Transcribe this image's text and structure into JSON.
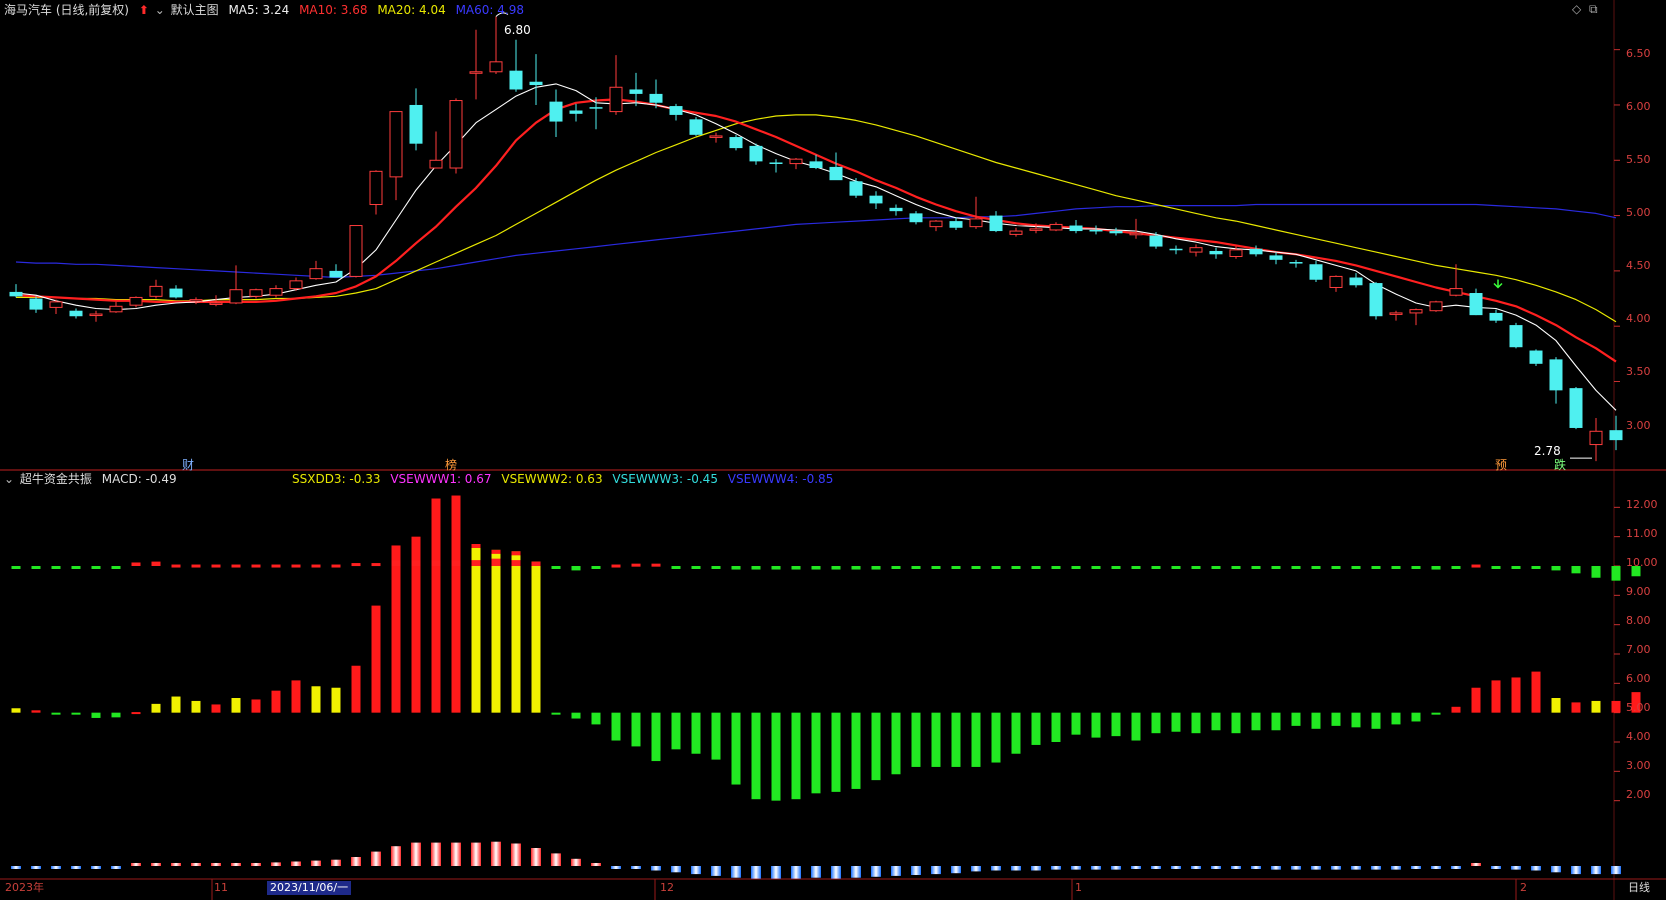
{
  "main_header": {
    "stock_title": "海马汽车 (日线,前复权)",
    "template": "默认主图",
    "ma5": "MA5: 3.24",
    "ma10": "MA10: 3.68",
    "ma20": "MA20: 4.04",
    "ma60": "MA60: 4.98"
  },
  "sub_header": {
    "indicator": "超牛资金共振",
    "macd": "MACD: -0.49",
    "ssxdd3": "SSXDD3: -0.33",
    "vw1": "VSEWWW1: 0.67",
    "vw2": "VSEWWW2: 0.63",
    "vw3": "VSEWWW3: -0.45",
    "vw4": "VSEWWW4: -0.85"
  },
  "markers": {
    "high": "6.80",
    "low": "2.78",
    "cai": "财",
    "bang": "榜",
    "yu": "预",
    "die": "跌"
  },
  "price_axis": [
    "6.50",
    "6.00",
    "5.50",
    "5.00",
    "4.50",
    "4.00",
    "3.50",
    "3.00"
  ],
  "osc_axis": [
    "12.00",
    "11.00",
    "10.00",
    "9.00",
    "8.00",
    "7.00",
    "6.00",
    "5.00",
    "4.00",
    "3.00",
    "2.00"
  ],
  "date_axis": {
    "year": "2023年",
    "nov": "11",
    "selected_date": "2023/11/06/一",
    "dec": "12",
    "jan": "1",
    "feb": "2",
    "period": "日线"
  },
  "colors": {
    "bull": "#ff3d3d",
    "bear": "#4ff0f0",
    "ma5": "#ffffff",
    "ma10": "#ff2020",
    "ma20": "#e8e800",
    "ma60": "#2a2adf",
    "grid": "#5a0f0f"
  },
  "chart_data": {
    "type": "candlestick",
    "ylim": [
      2.7,
      6.75
    ],
    "candles": [
      {
        "o": 4.31,
        "h": 4.38,
        "l": 4.26,
        "c": 4.27
      },
      {
        "o": 4.25,
        "h": 4.27,
        "l": 4.12,
        "c": 4.15
      },
      {
        "o": 4.17,
        "h": 4.24,
        "l": 4.11,
        "c": 4.22
      },
      {
        "o": 4.14,
        "h": 4.16,
        "l": 4.07,
        "c": 4.09
      },
      {
        "o": 4.1,
        "h": 4.14,
        "l": 4.04,
        "c": 4.11
      },
      {
        "o": 4.13,
        "h": 4.22,
        "l": 4.12,
        "c": 4.18
      },
      {
        "o": 4.19,
        "h": 4.27,
        "l": 4.17,
        "c": 4.26
      },
      {
        "o": 4.27,
        "h": 4.42,
        "l": 4.25,
        "c": 4.36
      },
      {
        "o": 4.34,
        "h": 4.37,
        "l": 4.25,
        "c": 4.26
      },
      {
        "o": 4.23,
        "h": 4.26,
        "l": 4.2,
        "c": 4.24
      },
      {
        "o": 4.2,
        "h": 4.28,
        "l": 4.18,
        "c": 4.21
      },
      {
        "o": 4.21,
        "h": 4.55,
        "l": 4.2,
        "c": 4.33
      },
      {
        "o": 4.27,
        "h": 4.34,
        "l": 4.25,
        "c": 4.33
      },
      {
        "o": 4.28,
        "h": 4.37,
        "l": 4.26,
        "c": 4.34
      },
      {
        "o": 4.34,
        "h": 4.44,
        "l": 4.32,
        "c": 4.41
      },
      {
        "o": 4.43,
        "h": 4.59,
        "l": 4.42,
        "c": 4.52
      },
      {
        "o": 4.5,
        "h": 4.56,
        "l": 4.46,
        "c": 4.44
      },
      {
        "o": 4.45,
        "h": 4.91,
        "l": 4.44,
        "c": 4.91
      },
      {
        "o": 5.1,
        "h": 5.41,
        "l": 5.01,
        "c": 5.4
      },
      {
        "o": 5.35,
        "h": 5.94,
        "l": 5.14,
        "c": 5.94
      },
      {
        "o": 6.0,
        "h": 6.15,
        "l": 5.59,
        "c": 5.65
      },
      {
        "o": 5.43,
        "h": 5.76,
        "l": 5.43,
        "c": 5.5
      },
      {
        "o": 5.43,
        "h": 6.06,
        "l": 5.38,
        "c": 6.04
      },
      {
        "o": 6.3,
        "h": 6.68,
        "l": 6.05,
        "c": 6.3
      },
      {
        "o": 6.3,
        "h": 6.8,
        "l": 6.28,
        "c": 6.39
      },
      {
        "o": 6.31,
        "h": 6.59,
        "l": 6.12,
        "c": 6.14
      },
      {
        "o": 6.21,
        "h": 6.46,
        "l": 6.0,
        "c": 6.18
      },
      {
        "o": 6.03,
        "h": 6.14,
        "l": 5.71,
        "c": 5.85
      },
      {
        "o": 5.95,
        "h": 6.01,
        "l": 5.85,
        "c": 5.92
      },
      {
        "o": 5.98,
        "h": 6.07,
        "l": 5.78,
        "c": 5.97
      },
      {
        "o": 5.94,
        "h": 6.45,
        "l": 5.91,
        "c": 6.16
      },
      {
        "o": 6.14,
        "h": 6.29,
        "l": 5.99,
        "c": 6.1
      },
      {
        "o": 6.1,
        "h": 6.23,
        "l": 5.97,
        "c": 6.02
      },
      {
        "o": 5.99,
        "h": 6.01,
        "l": 5.86,
        "c": 5.91
      },
      {
        "o": 5.87,
        "h": 5.89,
        "l": 5.72,
        "c": 5.73
      },
      {
        "o": 5.71,
        "h": 5.75,
        "l": 5.66,
        "c": 5.72
      },
      {
        "o": 5.71,
        "h": 5.73,
        "l": 5.59,
        "c": 5.61
      },
      {
        "o": 5.63,
        "h": 5.65,
        "l": 5.46,
        "c": 5.49
      },
      {
        "o": 5.48,
        "h": 5.51,
        "l": 5.39,
        "c": 5.47
      },
      {
        "o": 5.47,
        "h": 5.52,
        "l": 5.42,
        "c": 5.51
      },
      {
        "o": 5.49,
        "h": 5.55,
        "l": 5.42,
        "c": 5.43
      },
      {
        "o": 5.44,
        "h": 5.57,
        "l": 5.33,
        "c": 5.32
      },
      {
        "o": 5.31,
        "h": 5.34,
        "l": 5.16,
        "c": 5.18
      },
      {
        "o": 5.18,
        "h": 5.22,
        "l": 5.06,
        "c": 5.11
      },
      {
        "o": 5.07,
        "h": 5.1,
        "l": 5.0,
        "c": 5.04
      },
      {
        "o": 5.02,
        "h": 5.04,
        "l": 4.92,
        "c": 4.94
      },
      {
        "o": 4.9,
        "h": 4.96,
        "l": 4.86,
        "c": 4.95
      },
      {
        "o": 4.95,
        "h": 4.98,
        "l": 4.87,
        "c": 4.89
      },
      {
        "o": 4.9,
        "h": 5.17,
        "l": 4.88,
        "c": 4.97
      },
      {
        "o": 5.0,
        "h": 5.04,
        "l": 4.85,
        "c": 4.86
      },
      {
        "o": 4.83,
        "h": 4.89,
        "l": 4.81,
        "c": 4.86
      },
      {
        "o": 4.87,
        "h": 4.93,
        "l": 4.84,
        "c": 4.88
      },
      {
        "o": 4.87,
        "h": 4.94,
        "l": 4.86,
        "c": 4.92
      },
      {
        "o": 4.91,
        "h": 4.96,
        "l": 4.84,
        "c": 4.86
      },
      {
        "o": 4.87,
        "h": 4.91,
        "l": 4.83,
        "c": 4.86
      },
      {
        "o": 4.86,
        "h": 4.89,
        "l": 4.82,
        "c": 4.84
      },
      {
        "o": 4.83,
        "h": 4.97,
        "l": 4.79,
        "c": 4.84
      },
      {
        "o": 4.82,
        "h": 4.85,
        "l": 4.7,
        "c": 4.72
      },
      {
        "o": 4.7,
        "h": 4.73,
        "l": 4.65,
        "c": 4.69
      },
      {
        "o": 4.67,
        "h": 4.74,
        "l": 4.63,
        "c": 4.71
      },
      {
        "o": 4.68,
        "h": 4.71,
        "l": 4.61,
        "c": 4.65
      },
      {
        "o": 4.63,
        "h": 4.72,
        "l": 4.61,
        "c": 4.69
      },
      {
        "o": 4.7,
        "h": 4.73,
        "l": 4.63,
        "c": 4.65
      },
      {
        "o": 4.64,
        "h": 4.67,
        "l": 4.56,
        "c": 4.6
      },
      {
        "o": 4.58,
        "h": 4.6,
        "l": 4.53,
        "c": 4.57
      },
      {
        "o": 4.56,
        "h": 4.59,
        "l": 4.4,
        "c": 4.42
      },
      {
        "o": 4.35,
        "h": 4.46,
        "l": 4.31,
        "c": 4.45
      },
      {
        "o": 4.44,
        "h": 4.48,
        "l": 4.35,
        "c": 4.37
      },
      {
        "o": 4.39,
        "h": 4.4,
        "l": 4.06,
        "c": 4.09
      },
      {
        "o": 4.12,
        "h": 4.14,
        "l": 4.05,
        "c": 4.12
      },
      {
        "o": 4.12,
        "h": 4.16,
        "l": 4.01,
        "c": 4.15
      },
      {
        "o": 4.14,
        "h": 4.23,
        "l": 4.13,
        "c": 4.22
      },
      {
        "o": 4.28,
        "h": 4.56,
        "l": 4.27,
        "c": 4.34
      },
      {
        "o": 4.3,
        "h": 4.34,
        "l": 4.1,
        "c": 4.1
      },
      {
        "o": 4.12,
        "h": 4.15,
        "l": 4.03,
        "c": 4.05
      },
      {
        "o": 4.01,
        "h": 4.03,
        "l": 3.8,
        "c": 3.81
      },
      {
        "o": 3.78,
        "h": 3.79,
        "l": 3.64,
        "c": 3.66
      },
      {
        "o": 3.7,
        "h": 3.72,
        "l": 3.3,
        "c": 3.42
      },
      {
        "o": 3.44,
        "h": 3.45,
        "l": 3.07,
        "c": 3.08
      },
      {
        "o": 2.93,
        "h": 3.17,
        "l": 2.78,
        "c": 3.05
      },
      {
        "o": 3.06,
        "h": 3.19,
        "l": 2.88,
        "c": 2.97
      }
    ],
    "ma": {
      "ma5": {
        "name": "MA5",
        "values": [
          4.3,
          4.28,
          4.23,
          4.19,
          4.16,
          4.15,
          4.16,
          4.19,
          4.21,
          4.22,
          4.24,
          4.26,
          4.27,
          4.29,
          4.33,
          4.37,
          4.4,
          4.52,
          4.69,
          4.96,
          5.23,
          5.45,
          5.64,
          5.84,
          5.96,
          6.08,
          6.16,
          6.19,
          6.13,
          6.02,
          6.01,
          6.02,
          6.0,
          5.96,
          5.91,
          5.83,
          5.74,
          5.64,
          5.56,
          5.49,
          5.44,
          5.38,
          5.31,
          5.26,
          5.18,
          5.1,
          5.03,
          4.98,
          4.96,
          4.93,
          4.91,
          4.9,
          4.89,
          4.88,
          4.88,
          4.87,
          4.86,
          4.83,
          4.79,
          4.76,
          4.72,
          4.7,
          4.69,
          4.67,
          4.65,
          4.6,
          4.55,
          4.5,
          4.38,
          4.29,
          4.21,
          4.17,
          4.19,
          4.17,
          4.16,
          4.1,
          4.01,
          3.87,
          3.64,
          3.42,
          3.24
        ]
      },
      "ma10": {
        "name": "MA10",
        "values": [
          4.28,
          4.27,
          4.26,
          4.25,
          4.24,
          4.23,
          4.23,
          4.22,
          4.22,
          4.22,
          4.22,
          4.22,
          4.22,
          4.23,
          4.25,
          4.27,
          4.3,
          4.36,
          4.45,
          4.59,
          4.75,
          4.9,
          5.08,
          5.25,
          5.45,
          5.68,
          5.84,
          5.96,
          6.02,
          6.04,
          6.05,
          6.03,
          6.0,
          5.96,
          5.93,
          5.9,
          5.85,
          5.78,
          5.71,
          5.63,
          5.55,
          5.47,
          5.4,
          5.32,
          5.25,
          5.17,
          5.1,
          5.04,
          4.99,
          4.96,
          4.93,
          4.91,
          4.9,
          4.89,
          4.88,
          4.86,
          4.84,
          4.82,
          4.8,
          4.78,
          4.76,
          4.73,
          4.7,
          4.67,
          4.65,
          4.62,
          4.59,
          4.55,
          4.5,
          4.45,
          4.4,
          4.35,
          4.31,
          4.27,
          4.23,
          4.18,
          4.1,
          4.01,
          3.9,
          3.8,
          3.68
        ]
      },
      "ma20": {
        "name": "MA20",
        "values": [
          4.26,
          4.26,
          4.26,
          4.25,
          4.25,
          4.24,
          4.24,
          4.24,
          4.23,
          4.23,
          4.24,
          4.24,
          4.24,
          4.25,
          4.25,
          4.26,
          4.27,
          4.3,
          4.34,
          4.42,
          4.5,
          4.58,
          4.66,
          4.74,
          4.82,
          4.92,
          5.02,
          5.12,
          5.22,
          5.32,
          5.41,
          5.49,
          5.57,
          5.64,
          5.71,
          5.77,
          5.83,
          5.87,
          5.9,
          5.91,
          5.91,
          5.89,
          5.86,
          5.82,
          5.77,
          5.72,
          5.66,
          5.6,
          5.54,
          5.48,
          5.43,
          5.38,
          5.33,
          5.28,
          5.23,
          5.18,
          5.14,
          5.1,
          5.06,
          5.02,
          4.98,
          4.95,
          4.91,
          4.87,
          4.83,
          4.79,
          4.75,
          4.71,
          4.67,
          4.63,
          4.59,
          4.55,
          4.52,
          4.49,
          4.46,
          4.42,
          4.37,
          4.31,
          4.24,
          4.15,
          4.04
        ]
      },
      "ma60": {
        "name": "MA60",
        "values": [
          4.58,
          4.57,
          4.57,
          4.56,
          4.56,
          4.55,
          4.54,
          4.53,
          4.52,
          4.51,
          4.5,
          4.49,
          4.48,
          4.47,
          4.46,
          4.45,
          4.44,
          4.45,
          4.46,
          4.48,
          4.5,
          4.52,
          4.55,
          4.58,
          4.61,
          4.64,
          4.66,
          4.68,
          4.7,
          4.72,
          4.74,
          4.76,
          4.78,
          4.8,
          4.82,
          4.84,
          4.86,
          4.88,
          4.9,
          4.92,
          4.93,
          4.94,
          4.95,
          4.96,
          4.97,
          4.98,
          4.98,
          4.98,
          4.99,
          4.99,
          5.0,
          5.02,
          5.04,
          5.06,
          5.07,
          5.08,
          5.08,
          5.09,
          5.09,
          5.09,
          5.09,
          5.09,
          5.1,
          5.1,
          5.1,
          5.1,
          5.1,
          5.1,
          5.1,
          5.1,
          5.1,
          5.1,
          5.1,
          5.1,
          5.09,
          5.08,
          5.07,
          5.06,
          5.04,
          5.02,
          4.98
        ]
      }
    },
    "oscillator": {
      "ylim": [
        1.0,
        13.0
      ],
      "baseline": 5.0,
      "bars": [
        5.15,
        5.08,
        4.98,
        4.98,
        4.82,
        4.84,
        5.02,
        5.3,
        5.55,
        5.4,
        5.28,
        5.5,
        5.45,
        5.75,
        6.1,
        5.9,
        5.85,
        6.6,
        8.65,
        10.7,
        11.0,
        12.3,
        12.4,
        10.75,
        10.55,
        10.5,
        10.15,
        4.95,
        4.8,
        4.6,
        4.05,
        3.85,
        3.35,
        3.75,
        3.6,
        3.4,
        2.55,
        2.05,
        2.0,
        2.05,
        2.25,
        2.3,
        2.4,
        2.7,
        2.9,
        3.15,
        3.15,
        3.15,
        3.15,
        3.3,
        3.6,
        3.9,
        4.0,
        4.25,
        4.15,
        4.2,
        4.05,
        4.3,
        4.35,
        4.3,
        4.4,
        4.3,
        4.4,
        4.4,
        4.55,
        4.45,
        4.55,
        4.5,
        4.45,
        4.6,
        4.7,
        4.95,
        5.2,
        5.85,
        6.1,
        6.2,
        6.4,
        5.5,
        5.35,
        5.4,
        5.4,
        5.7
      ]
    },
    "signal_line": {
      "values": [
        10.0,
        10.0,
        10.0,
        9.9,
        9.95,
        10.0,
        10.12,
        10.15,
        10.05,
        10.05,
        10.05,
        10.05,
        10.05,
        10.05,
        10.05,
        10.05,
        10.05,
        10.1,
        10.1,
        10.2,
        10.2,
        10.2,
        10.2,
        10.2,
        10.25,
        10.2,
        10.15,
        9.95,
        9.85,
        9.95,
        10.05,
        10.08,
        10.08,
        9.98,
        9.92,
        9.92,
        9.88,
        9.88,
        9.88,
        9.88,
        9.88,
        9.88,
        9.88,
        9.88,
        9.9,
        9.9,
        9.9,
        9.92,
        9.92,
        9.92,
        9.9,
        9.92,
        9.92,
        9.92,
        9.93,
        9.95,
        9.96,
        9.96,
        9.95,
        9.95,
        9.95,
        9.95,
        9.95,
        9.95,
        9.95,
        9.95,
        9.95,
        9.95,
        9.95,
        9.95,
        9.92,
        9.88,
        9.9,
        10.05,
        9.98,
        9.96,
        9.92,
        9.85,
        9.75,
        9.6,
        9.5,
        9.65
      ]
    },
    "macd_bars": [
      -0.03,
      -0.02,
      -0.02,
      -0.03,
      -0.03,
      -0.03,
      0.01,
      0.02,
      0.01,
      0.01,
      0.02,
      0.02,
      0.03,
      0.04,
      0.05,
      0.06,
      0.07,
      0.1,
      0.16,
      0.22,
      0.26,
      0.26,
      0.26,
      0.26,
      0.27,
      0.25,
      0.2,
      0.14,
      0.08,
      0.03,
      -0.01,
      -0.03,
      -0.05,
      -0.07,
      -0.09,
      -0.11,
      -0.13,
      -0.14,
      -0.14,
      -0.14,
      -0.13,
      -0.14,
      -0.13,
      -0.12,
      -0.11,
      -0.1,
      -0.09,
      -0.08,
      -0.06,
      -0.05,
      -0.05,
      -0.05,
      -0.04,
      -0.04,
      -0.04,
      -0.04,
      -0.03,
      -0.03,
      -0.03,
      -0.03,
      -0.03,
      -0.03,
      -0.03,
      -0.04,
      -0.04,
      -0.04,
      -0.04,
      -0.04,
      -0.04,
      -0.04,
      -0.03,
      -0.02,
      -0.02,
      0.01,
      -0.02,
      -0.04,
      -0.05,
      -0.07,
      -0.09,
      -0.09,
      -0.09
    ]
  }
}
